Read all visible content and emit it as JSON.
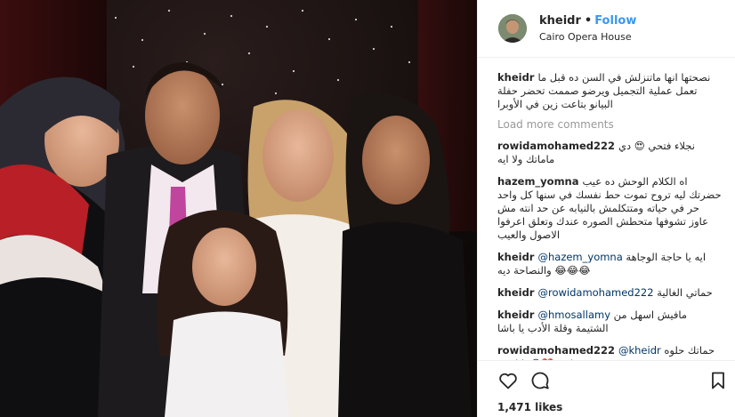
{
  "post": {
    "username": "kheidr",
    "separator": "•",
    "follow_label": "Follow",
    "location": "Cairo Opera House",
    "caption": "نصحتها انها ماتنزلش في السن ده قبل ما تعمل عملية التجميل ويرضو صممت تحضر حفلة البيانو بتاعت زين في الأوبرا",
    "load_more_label": "Load more comments",
    "likes": "1,471 likes"
  },
  "comments": [
    {
      "user": "rowidamohamed222",
      "text": "نجلاء فتحي 😍 دي ماماتك ولا ايه"
    },
    {
      "user": "hazem_yomna",
      "text": "اه الكلام الوحش ده عيب حضرتك ليه تروح تموت حط نفسك في سنها كل واحد حر في حياته ومتتكلمش بالنيابه عن حد انته مش عاوز تشوفها متحطش الصوره عندك وتعلق اعرفوا الاصول والعيب"
    },
    {
      "user": "kheidr",
      "mention": "@hazem_yomna",
      "text": "ايه يا حاجة الوجاهة والنصاحة ديه 😂😂😂"
    },
    {
      "user": "kheidr",
      "mention": "@rowidamohamed222",
      "text": "حماتي الغالية"
    },
    {
      "user": "kheidr",
      "mention": "@hmosallamy",
      "text": "مافيش اسهل من الشتيمة وقلة الأدب يا باشا"
    },
    {
      "user": "rowidamohamed222",
      "mention": "@kheidr",
      "text": "حماتك حلوه اوي ❤️😊 يا لمبي"
    }
  ],
  "icons": {
    "like": "heart-icon",
    "comment": "comment-icon",
    "save": "bookmark-icon"
  },
  "colors": {
    "link_blue": "#3897f0",
    "muted_grey": "#999999",
    "mention_blue": "#003569",
    "text": "#262626"
  }
}
